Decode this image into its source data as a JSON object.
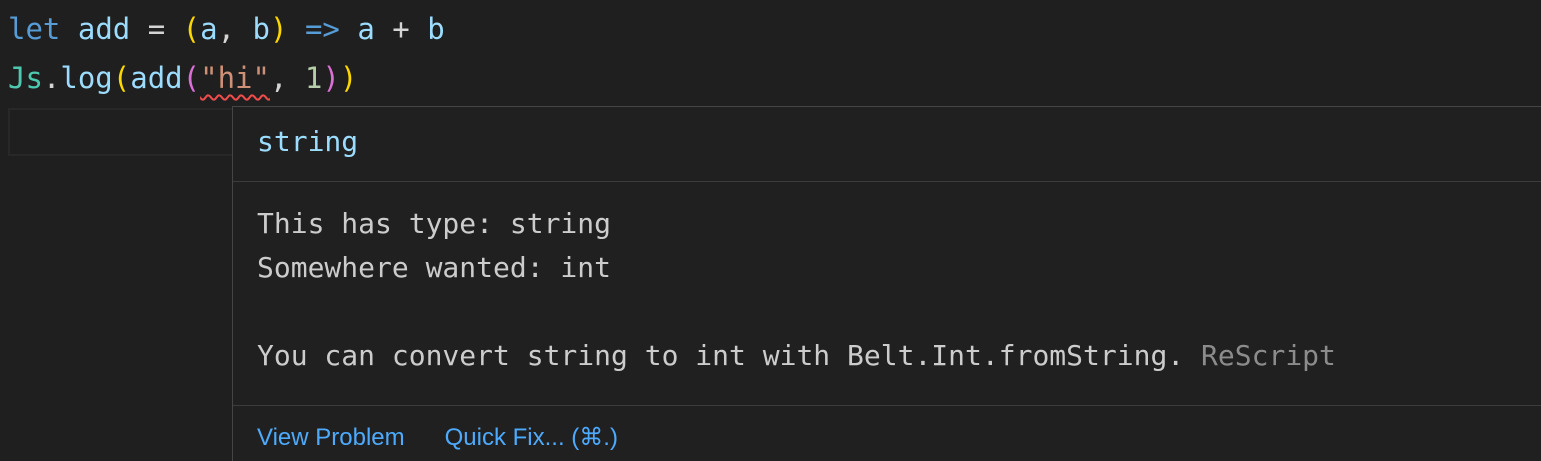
{
  "editor": {
    "line1": {
      "kw_let": "let",
      "name": "add",
      "eq": "=",
      "open": "(",
      "param_a": "a",
      "comma": ",",
      "param_b": "b",
      "close": ")",
      "arrow": "=>",
      "body_a": "a",
      "plus": "+",
      "body_b": "b"
    },
    "line2": {
      "module": "Js",
      "dot": ".",
      "method": "log",
      "open1": "(",
      "fn": "add",
      "open2": "(",
      "arg_str": "\"hi\"",
      "comma": ",",
      "arg_num": "1",
      "close2": ")",
      "close1": ")"
    }
  },
  "hover": {
    "title": "string",
    "line1": "This has type: string",
    "line2": "Somewhere wanted: int",
    "line3_main": "You can convert string to int with Belt.Int.fromString.",
    "line3_dim": "ReScript",
    "view_problem": "View Problem",
    "quick_fix": "Quick Fix... (⌘.)"
  },
  "colors": {
    "background": "#1f1f1f",
    "keyword": "#569cd6",
    "error_squiggle": "#f14c4c",
    "link": "#4daafc"
  }
}
